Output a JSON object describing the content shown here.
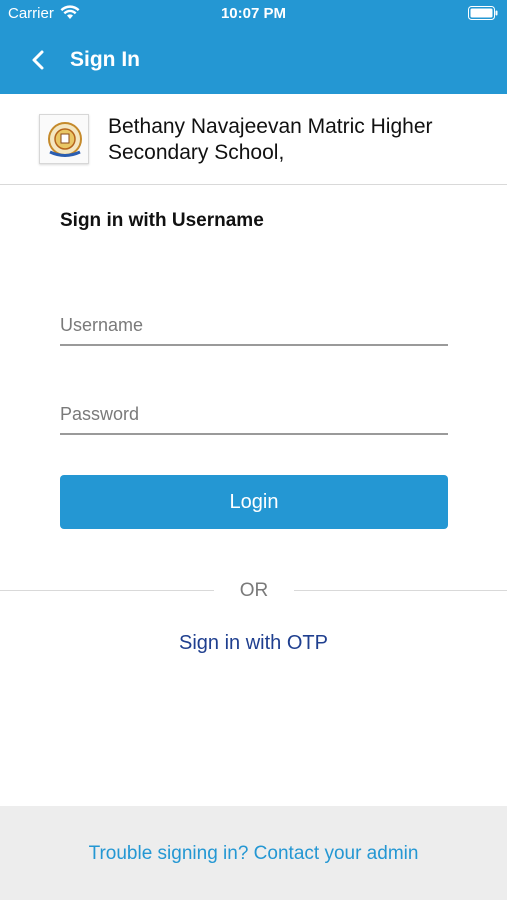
{
  "status_bar": {
    "carrier": "Carrier",
    "time": "10:07 PM",
    "wifi_icon": "wifi-icon",
    "battery_icon": "battery-icon"
  },
  "nav": {
    "title": "Sign In",
    "back_icon": "chevron-left-icon"
  },
  "school": {
    "name": "Bethany Navajeevan Matric Higher Secondary School,"
  },
  "form": {
    "heading": "Sign in with Username",
    "username_placeholder": "Username",
    "username_value": "",
    "password_placeholder": "Password",
    "password_value": "",
    "login_label": "Login",
    "or_label": "OR",
    "otp_label": "Sign in with OTP"
  },
  "footer": {
    "help_label": "Trouble signing in? Contact your admin"
  },
  "colors": {
    "primary": "#2497d3",
    "link_dark": "#1f3f8f",
    "footer_bg": "#ededed"
  }
}
